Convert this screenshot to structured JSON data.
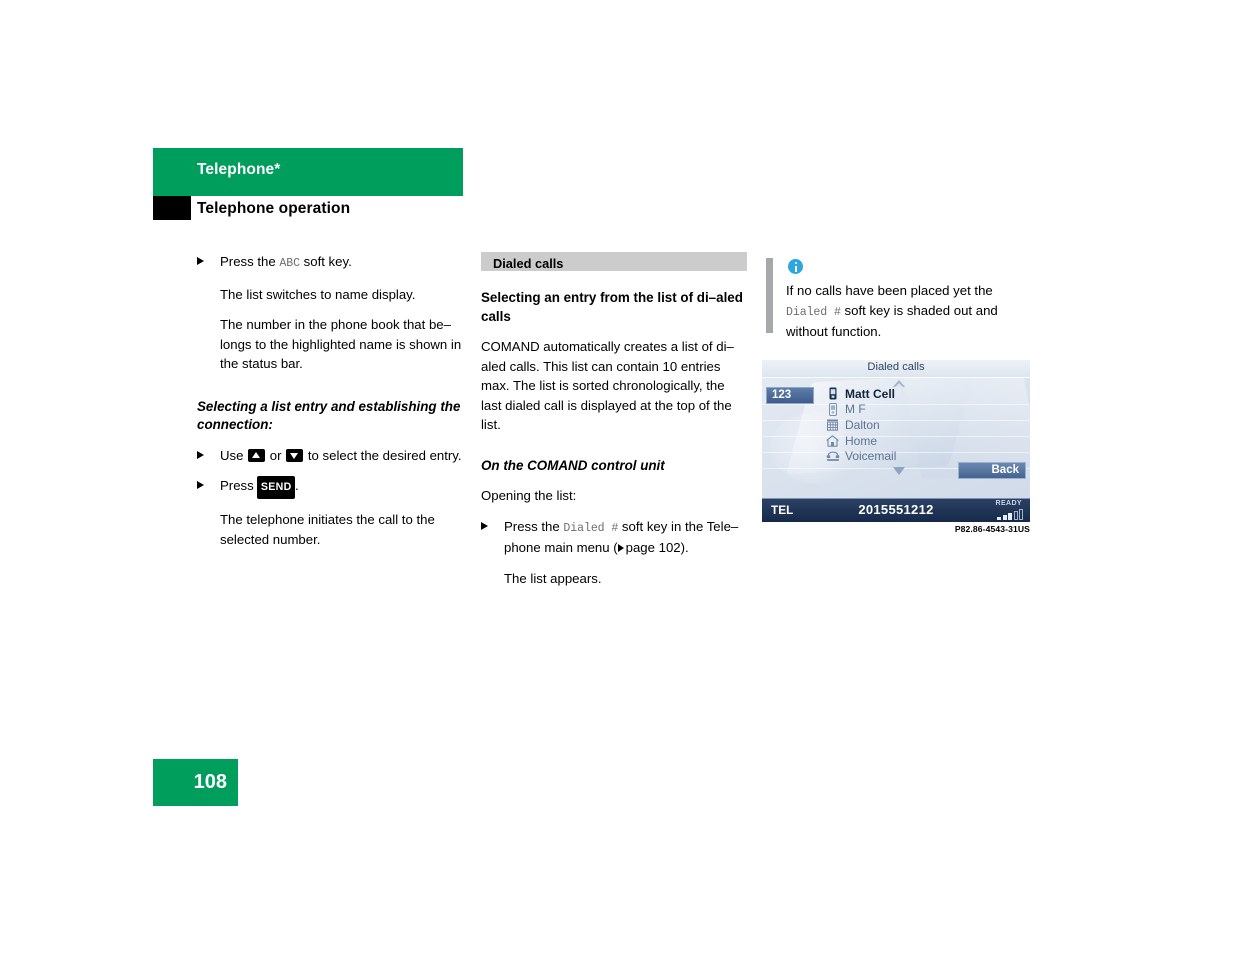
{
  "header": {
    "chapter_title": "Telephone*",
    "section_title": "Telephone operation",
    "green_hex": "#009e5c"
  },
  "left_column": {
    "step1_pre": "Press the",
    "step1_key": "ABC",
    "step1_post": "soft key.",
    "result1": "The list switches to name display.",
    "para1": "The number in the phone book that be–longs to the highlighted name is shown in the status bar.",
    "subheading": "Selecting a list entry and establishing the connection:",
    "step2_pre": "Use",
    "step2_mid": "or",
    "step2_post": "to select the desired entry.",
    "step3_pre": "Press",
    "step3_key": "SEND",
    "step3_post": ".",
    "result2": "The telephone initiates the call to the selected number."
  },
  "middle_column": {
    "section_head": "Dialed calls",
    "heading": "Selecting an entry from the list of di–aled calls",
    "para": "COMAND automatically creates a list of di–aled calls. This list can contain 10 entries max. The list is sorted chronologically, the last dialed call is displayed at the top of the list.",
    "subheading": "On the COMAND control unit",
    "opening": "Opening the list:",
    "step_pre": "Press the",
    "step_key": "Dialed #",
    "step_mid": "soft key in the Tele–phone main menu (",
    "step_ref": "page 102",
    "step_post": ").",
    "result": "The list appears."
  },
  "note": {
    "icon": "info-icon",
    "line_pre": "If no calls have been placed yet the",
    "key": "Dialed #",
    "line_post": "soft key is shaded out and without function."
  },
  "figure": {
    "caption": "P82.86-4543-31US",
    "screen": {
      "title": "Dialed calls",
      "badge": "123",
      "entries": [
        {
          "icon": "mobile-phone-icon",
          "label": "Matt Cell",
          "selected": true
        },
        {
          "icon": "mobile-phone-icon",
          "label": "M F",
          "selected": false
        },
        {
          "icon": "office-building-icon",
          "label": "Dalton",
          "selected": false
        },
        {
          "icon": "home-icon",
          "label": "Home",
          "selected": false
        },
        {
          "icon": "telephone-icon",
          "label": "Voicemail",
          "selected": false
        }
      ],
      "back_button": "Back",
      "status": {
        "mode": "TEL",
        "number": "2015551212",
        "ready": "READY",
        "signal_filled": 3,
        "signal_empty": 2
      }
    }
  },
  "footer": {
    "page_number": "108"
  }
}
